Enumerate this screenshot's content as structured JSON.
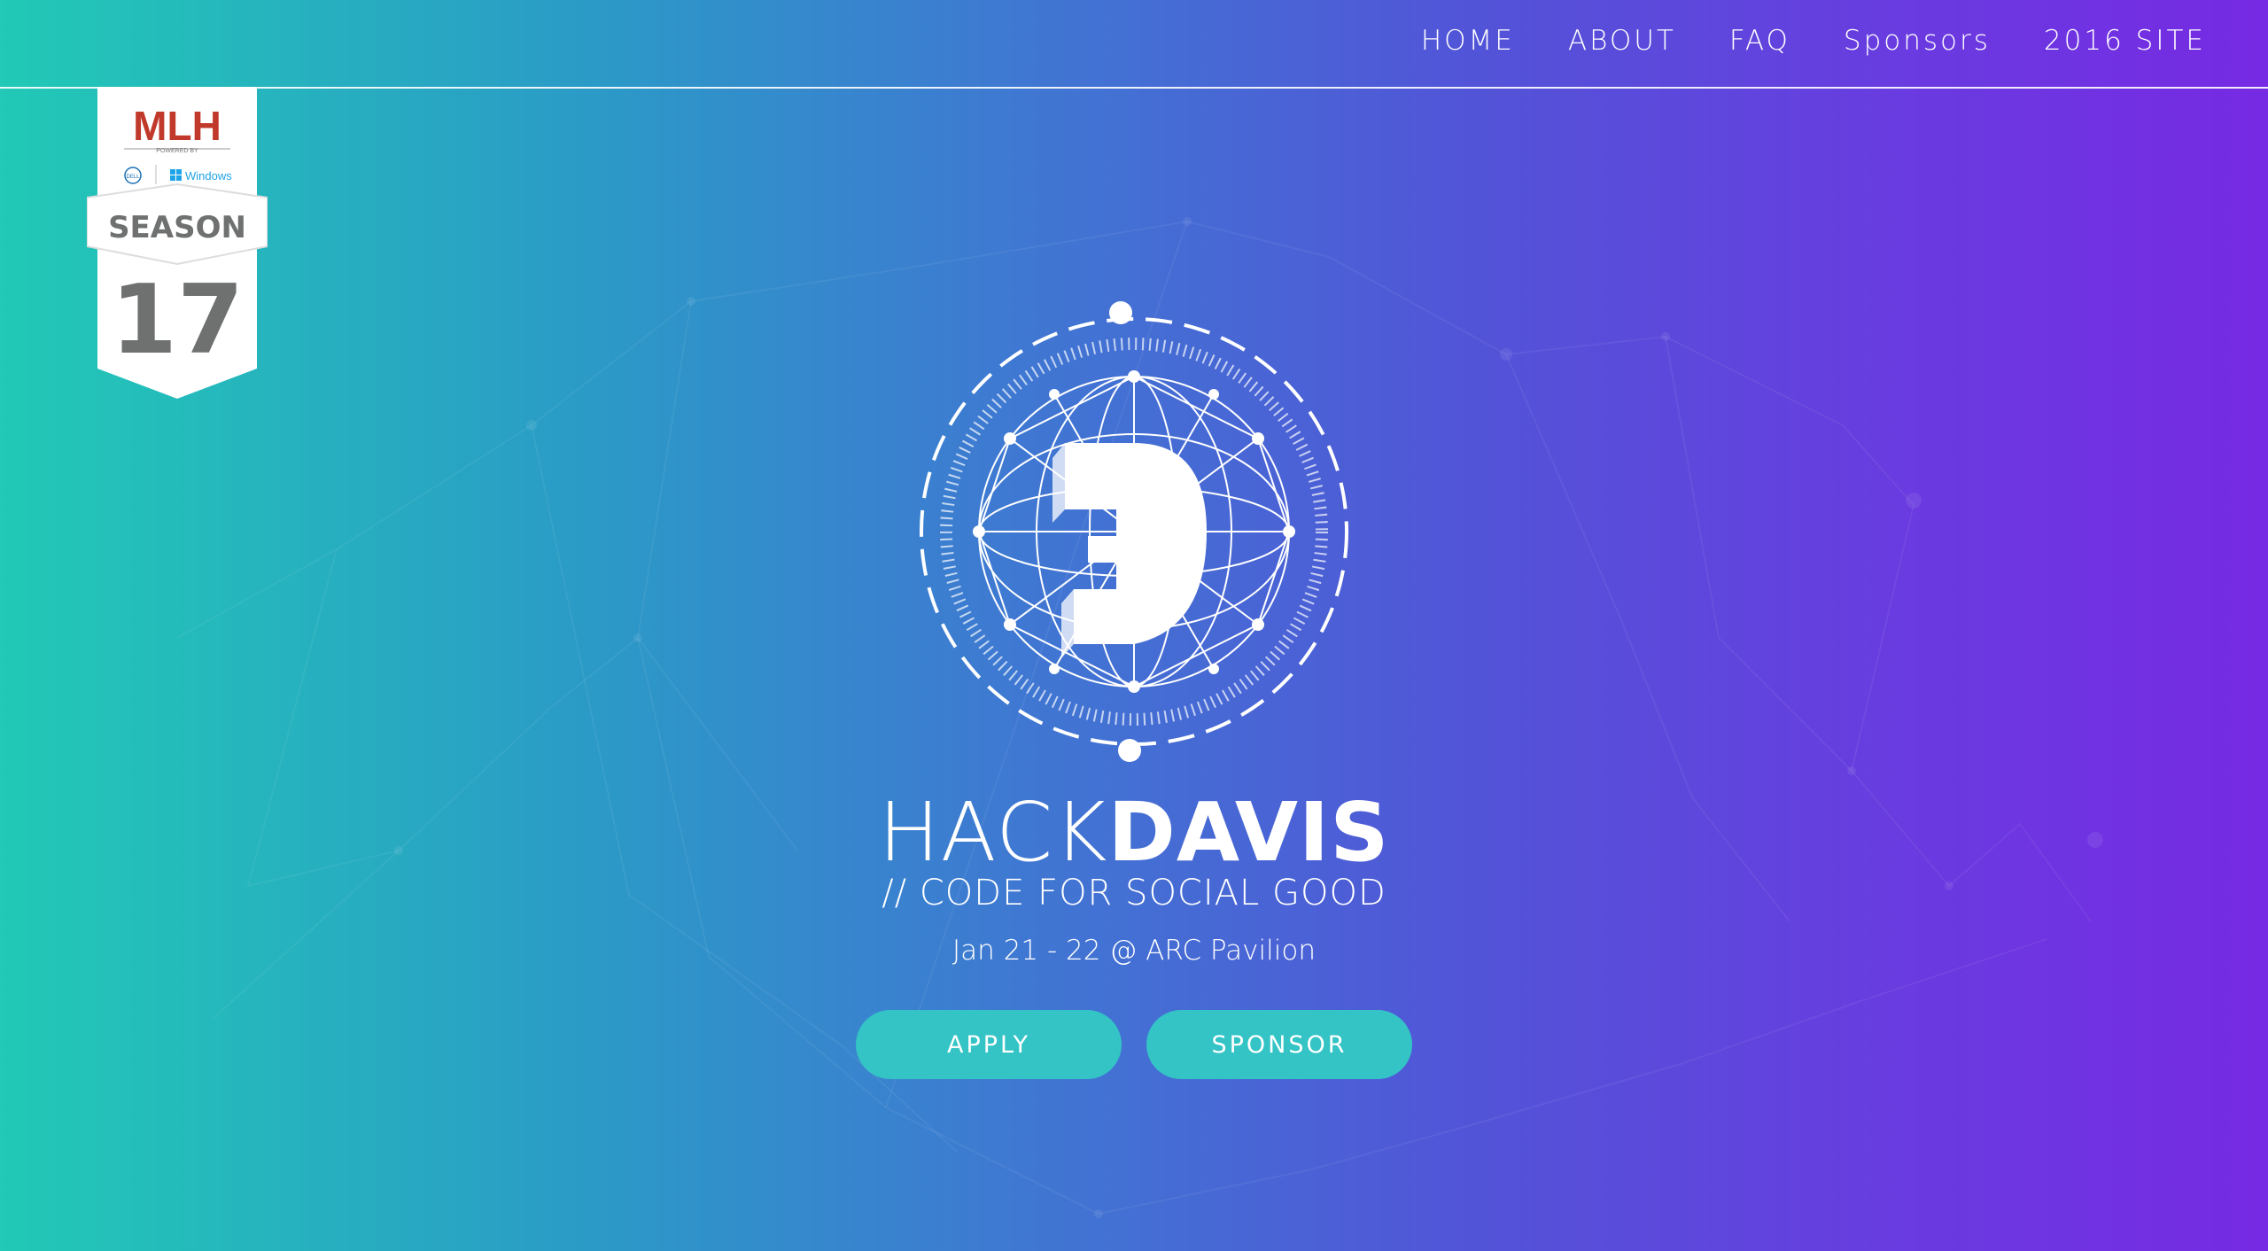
{
  "nav": {
    "items": [
      {
        "label": "HOME"
      },
      {
        "label": "ABOUT"
      },
      {
        "label": "FAQ"
      },
      {
        "label": "Sponsors"
      },
      {
        "label": "2016 SITE"
      }
    ]
  },
  "badge": {
    "org": "MLH",
    "powered_by": "POWERED BY",
    "sponsor1": "DELL",
    "sponsor2": "Windows",
    "season_label": "SEASON",
    "season_number": "17"
  },
  "hero": {
    "title_light": "HACK",
    "title_bold": "DAVIS",
    "subtitle": "// CODE FOR SOCIAL GOOD",
    "date_location": "Jan 21 - 22 @ ARC Pavilion",
    "apply_label": "APPLY",
    "sponsor_label": "SPONSOR"
  },
  "colors": {
    "gradient_start": "#22c9b6",
    "gradient_end": "#762ae3",
    "button": "#34c4c6",
    "badge_gray": "#6f7171"
  }
}
